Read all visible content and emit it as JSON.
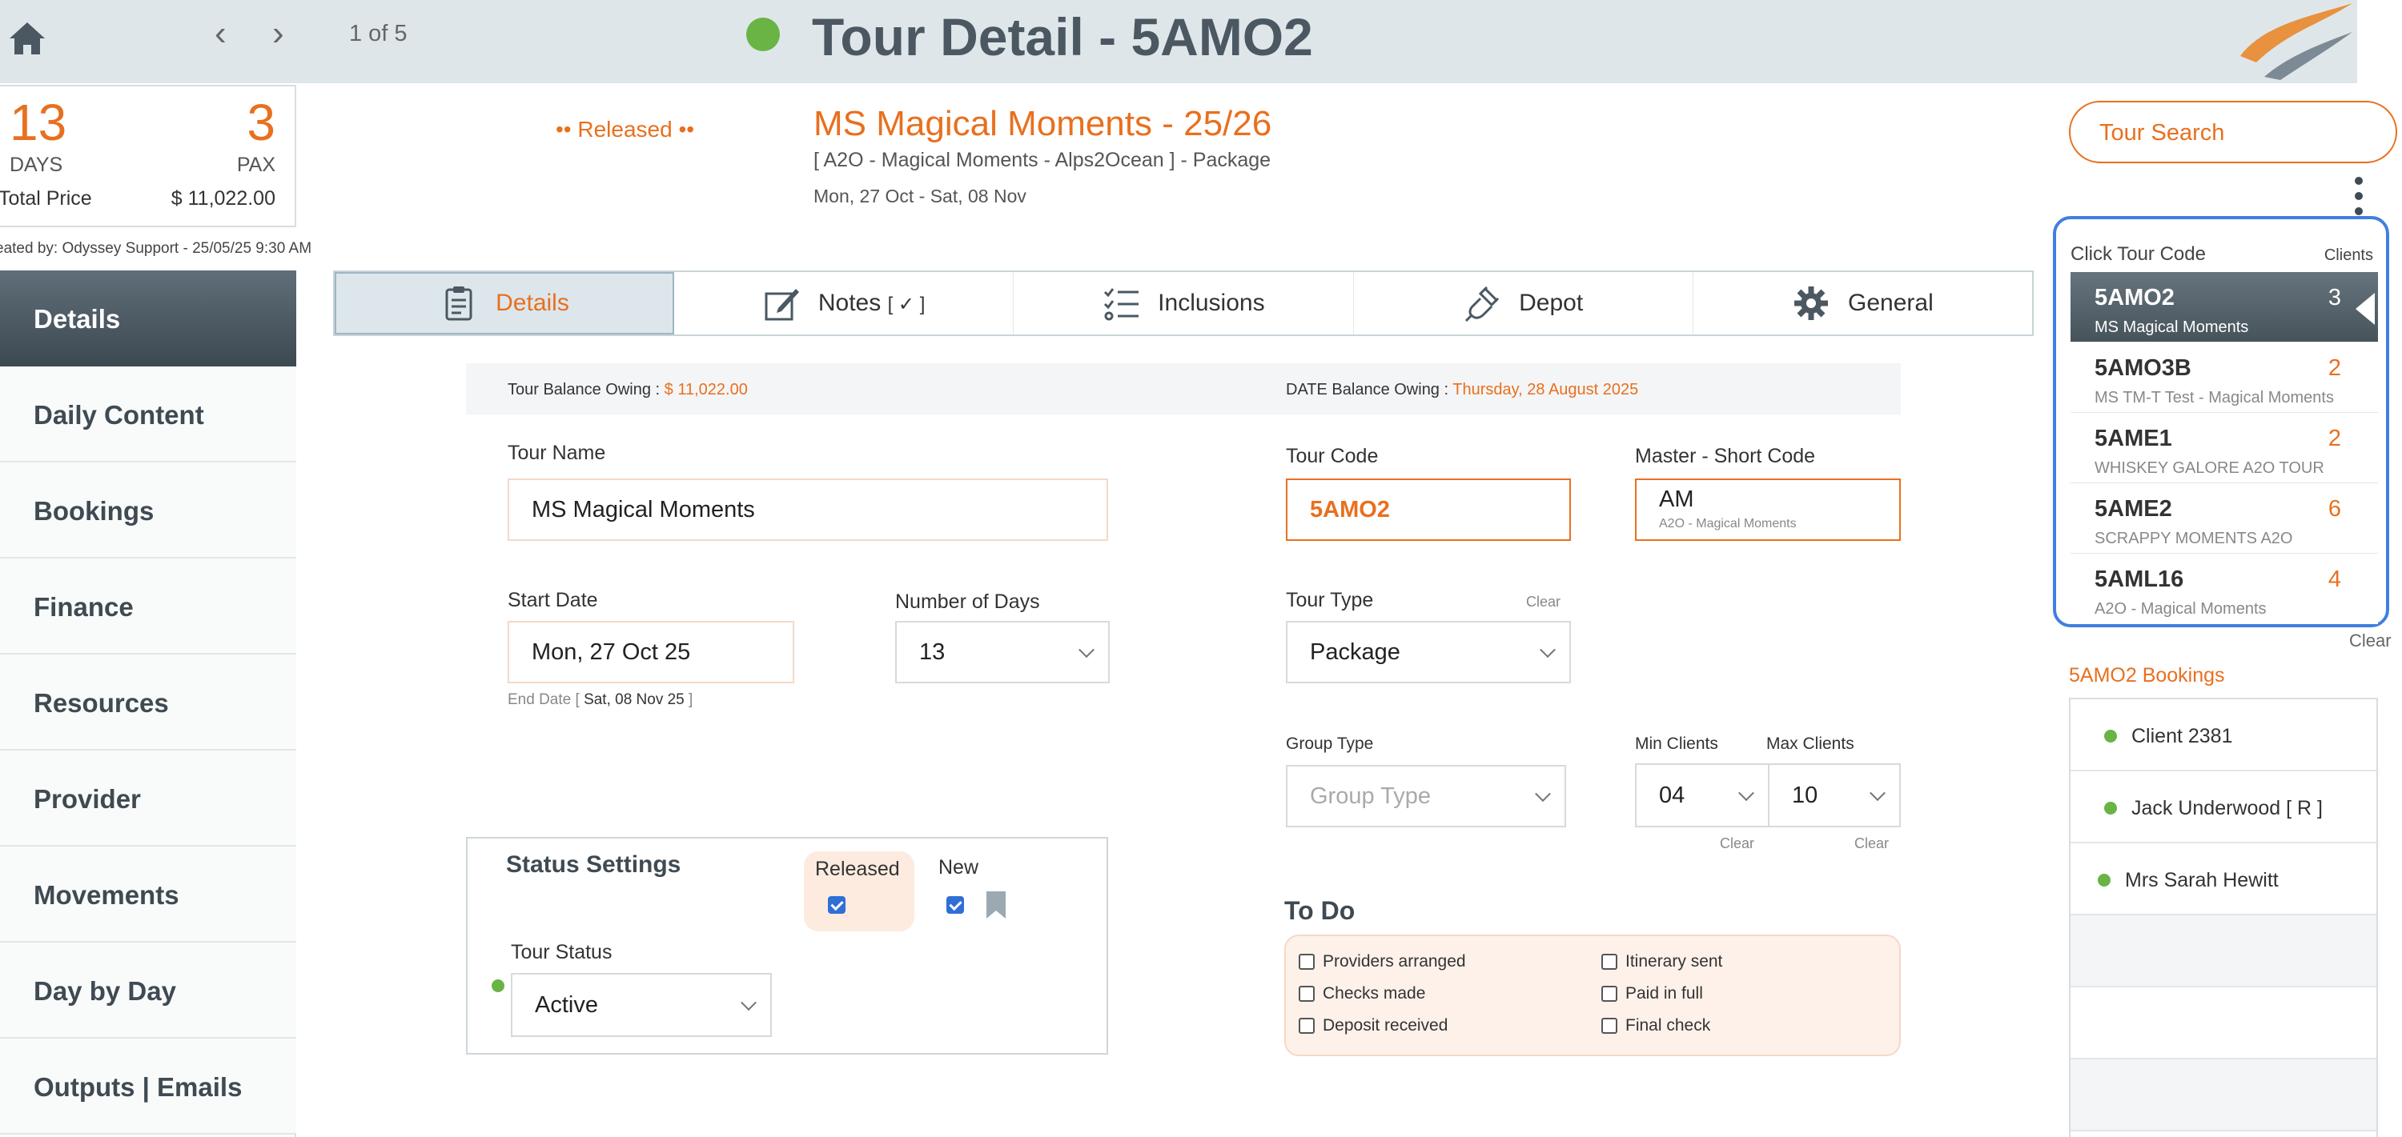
{
  "header": {
    "pager": "1 of 5",
    "title": "Tour Detail - 5AMO2"
  },
  "summary": {
    "days": "13",
    "days_label": "DAYS",
    "pax": "3",
    "pax_label": "PAX",
    "total_label": "Total Price",
    "total_value": "$ 11,022.00",
    "created_by": "eated by: Odyssey Support - 25/05/25 9:30 AM"
  },
  "tour_header": {
    "status_badge": "•• Released ••",
    "heading": "MS Magical Moments - 25/26",
    "subtitle": "[ A2O - Magical Moments - Alps2Ocean ] - Package",
    "dates": "Mon, 27 Oct  - Sat, 08 Nov"
  },
  "nav": {
    "items": [
      "Details",
      "Daily Content",
      "Bookings",
      "Finance",
      "Resources",
      "Provider",
      "Movements",
      "Day by Day",
      "Outputs | Emails"
    ]
  },
  "tabs": {
    "details": "Details",
    "notes": "Notes",
    "notes_suffix": "[ ✓ ]",
    "inclusions": "Inclusions",
    "depot": "Depot",
    "general": "General"
  },
  "balance": {
    "tour_label": "Tour Balance Owing : ",
    "tour_value": "$ 11,022.00",
    "date_label": "DATE Balance Owing : ",
    "date_value": "Thursday, 28 August 2025"
  },
  "form": {
    "tour_name_label": "Tour Name",
    "tour_name": "MS Magical Moments",
    "start_date_label": "Start Date",
    "start_date": "Mon, 27 Oct 25",
    "end_date_label": "End Date [",
    "end_date": "Sat, 08 Nov 25",
    "end_date_close": "]",
    "num_days_label": "Number of Days",
    "num_days": "13",
    "tour_code_label": "Tour Code",
    "tour_code": "5AMO2",
    "master_label": "Master - Short Code",
    "master_code": "AM",
    "master_sub": "A2O - Magical Moments",
    "tour_type_label": "Tour Type",
    "tour_type_clear": "Clear",
    "tour_type": "Package",
    "group_type_label": "Group Type",
    "group_type_placeholder": "Group Type",
    "min_clients_label": "Min Clients",
    "min_clients": "04",
    "min_clear": "Clear",
    "max_clients_label": "Max Clients",
    "max_clients": "10",
    "max_clear": "Clear"
  },
  "status_settings": {
    "title": "Status Settings",
    "released_label": "Released",
    "released_checked": true,
    "new_label": "New",
    "new_checked": true,
    "tour_status_label": "Tour Status",
    "tour_status": "Active"
  },
  "todo": {
    "title": "To Do",
    "items": [
      "Providers arranged",
      "Checks made",
      "Deposit received",
      "Itinerary sent",
      "Paid in full",
      "Final check"
    ]
  },
  "right_panel": {
    "search_label": "Tour Search",
    "click_label": "Click Tour Code",
    "clients_label": "Clients",
    "codes": [
      {
        "code": "5AMO2",
        "name": "MS Magical Moments",
        "count": "3"
      },
      {
        "code": "5AMO3B",
        "name": "MS TM-T Test - Magical Moments",
        "count": "2"
      },
      {
        "code": "5AME1",
        "name": "WHISKEY GALORE A2O TOUR",
        "count": "2"
      },
      {
        "code": "5AME2",
        "name": "SCRAPPY MOMENTS A2O",
        "count": "6"
      },
      {
        "code": "5AML16",
        "name": "A2O - Magical Moments",
        "count": "4"
      }
    ],
    "clear_label": "Clear",
    "bookings_label": "5AMO2 Bookings",
    "bookings": [
      "Client 2381",
      "Jack Underwood  [ R ]",
      "Mrs Sarah Hewitt"
    ]
  },
  "colors": {
    "accent": "#e8701f",
    "status_green": "#69b444",
    "selection_blue": "#3f7fe0",
    "nav_active": "#4b5862"
  }
}
